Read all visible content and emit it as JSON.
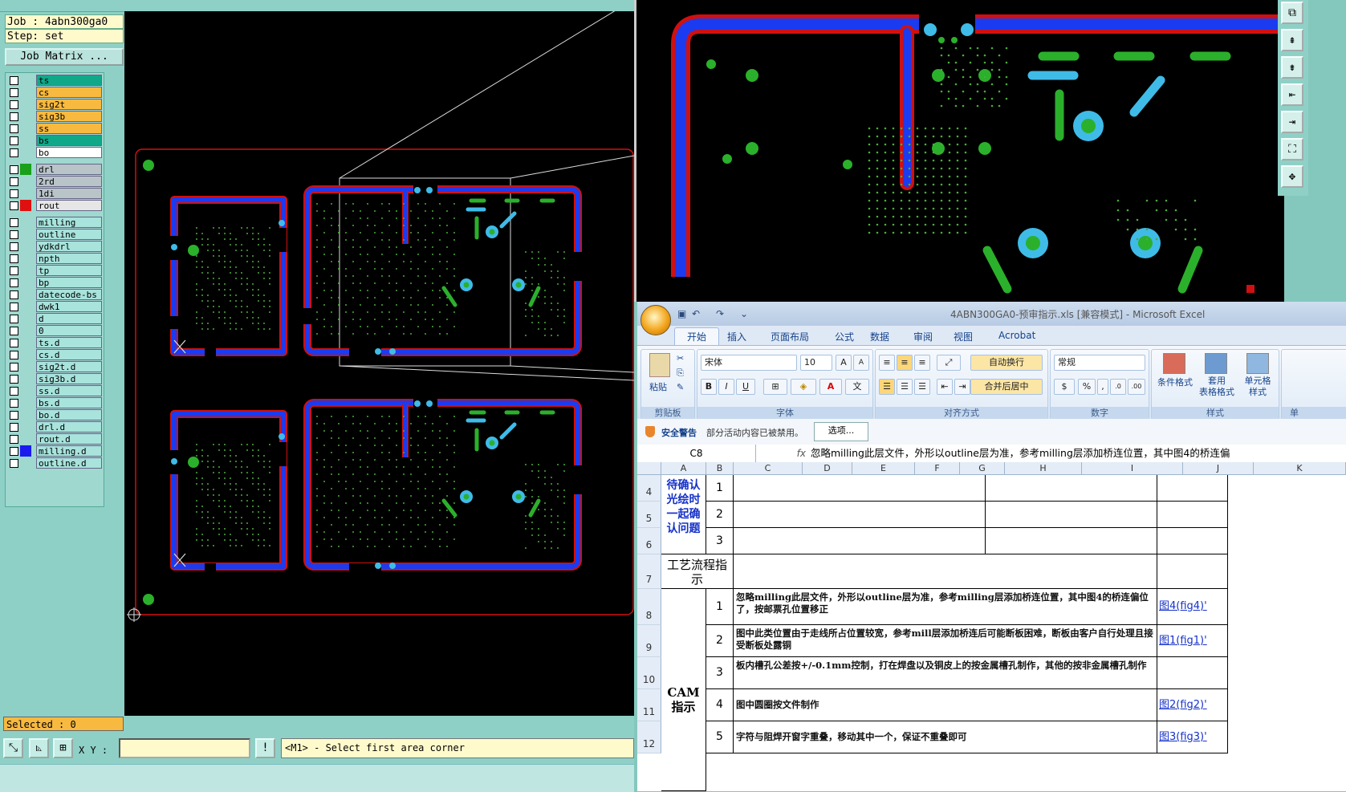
{
  "cam": {
    "job_line": "Job : 4abn300ga0",
    "step_line": "Step: set",
    "job_matrix_label": "Job Matrix ...",
    "layers": [
      {
        "name": "ts",
        "bg": "#11a88a",
        "swatch": ""
      },
      {
        "name": "cs",
        "bg": "#f7b93f",
        "swatch": ""
      },
      {
        "name": "sig2t",
        "bg": "#f7b93f",
        "swatch": ""
      },
      {
        "name": "sig3b",
        "bg": "#f7b93f",
        "swatch": ""
      },
      {
        "name": "ss",
        "bg": "#f7b93f",
        "swatch": ""
      },
      {
        "name": "bs",
        "bg": "#11a88a",
        "swatch": ""
      },
      {
        "name": "bo",
        "bg": "#ffffff",
        "swatch": ""
      },
      {
        "name": "drl",
        "bg": "#b8c4c8",
        "swatch": "#1aa01a"
      },
      {
        "name": "2rd",
        "bg": "#b8c4c8",
        "swatch": ""
      },
      {
        "name": "1di",
        "bg": "#b8c4c8",
        "swatch": ""
      },
      {
        "name": "rout",
        "bg": "#e6e6e6",
        "swatch": "#e01010"
      },
      {
        "name": "milling",
        "bg": "#a8e3dc",
        "swatch": ""
      },
      {
        "name": "outline",
        "bg": "#a8e3dc",
        "swatch": ""
      },
      {
        "name": "ydkdrl",
        "bg": "#a8e3dc",
        "swatch": ""
      },
      {
        "name": "npth",
        "bg": "#a8e3dc",
        "swatch": ""
      },
      {
        "name": "tp",
        "bg": "#a8e3dc",
        "swatch": ""
      },
      {
        "name": "bp",
        "bg": "#a8e3dc",
        "swatch": ""
      },
      {
        "name": "datecode-bs",
        "bg": "#a8e3dc",
        "swatch": ""
      },
      {
        "name": "dwk1",
        "bg": "#a8e3dc",
        "swatch": ""
      },
      {
        "name": "d",
        "bg": "#a8e3dc",
        "swatch": ""
      },
      {
        "name": "0",
        "bg": "#a8e3dc",
        "swatch": ""
      },
      {
        "name": "ts.d",
        "bg": "#a8e3dc",
        "swatch": ""
      },
      {
        "name": "cs.d",
        "bg": "#a8e3dc",
        "swatch": ""
      },
      {
        "name": "sig2t.d",
        "bg": "#a8e3dc",
        "swatch": ""
      },
      {
        "name": "sig3b.d",
        "bg": "#a8e3dc",
        "swatch": ""
      },
      {
        "name": "ss.d",
        "bg": "#a8e3dc",
        "swatch": ""
      },
      {
        "name": "bs.d",
        "bg": "#a8e3dc",
        "swatch": ""
      },
      {
        "name": "bo.d",
        "bg": "#a8e3dc",
        "swatch": ""
      },
      {
        "name": "drl.d",
        "bg": "#a8e3dc",
        "swatch": ""
      },
      {
        "name": "rout.d",
        "bg": "#a8e3dc",
        "swatch": ""
      },
      {
        "name": "milling.d",
        "bg": "#a8e3dc",
        "swatch": "#1b1bf0"
      },
      {
        "name": "outline.d",
        "bg": "#a8e3dc",
        "swatch": ""
      }
    ],
    "selected_label": "Selected : 0",
    "xy_label": "X Y :",
    "warn_glyph": "!",
    "status_message": "<M1> - Select first area corner"
  },
  "excel": {
    "title": "4ABN300GA0-预审指示.xls  [兼容模式] - Microsoft Excel",
    "tabs": [
      "开始",
      "插入",
      "页面布局",
      "公式",
      "数据",
      "审阅",
      "视图",
      "Acrobat"
    ],
    "groups": {
      "clipboard": "剪贴板",
      "font": "字体",
      "align": "对齐方式",
      "number": "数字",
      "styles": "样式",
      "cells": "单"
    },
    "paste_label": "粘贴",
    "font_name": "宋体",
    "font_size": "10",
    "wrap_label": "自动换行",
    "merge_label": "合并后居中",
    "number_format": "常规",
    "cond_format_label": "条件格式",
    "table_format_label": "套用\n表格格式",
    "cell_style_label": "单元格\n样式",
    "security_title": "安全警告",
    "security_msg": "部分活动内容已被禁用。",
    "security_btn": "选项...",
    "name_box": "C8",
    "fx": "fx",
    "formula": "忽略milling此层文件，外形以outline层为准，参考milling层添加桥连位置，其中图4的桥连偏",
    "columns": [
      "A",
      "B",
      "C",
      "D",
      "E",
      "F",
      "G",
      "H",
      "I",
      "J",
      "K"
    ],
    "rows": [
      "4",
      "5",
      "6",
      "7",
      "8",
      "9",
      "10",
      "11",
      "12"
    ],
    "confirm_label": "待确认光绘时一起确认问题",
    "process_label": "工艺流程指示",
    "cam_label": "CAM\n指示",
    "confirm_nums": [
      "1",
      "2",
      "3"
    ],
    "cam_items": [
      {
        "n": "1",
        "text": "忽略milling此层文件，外形以outline层为准，参考milling层添加桥连位置，其中图4的桥连偏位了，按邮票孔位置移正",
        "link": "图4(fig4)'"
      },
      {
        "n": "2",
        "text": "图中此类位置由于走线所占位置较宽，参考mill层添加桥连后可能断板困难，断板由客户自行处理且接受断板处露铜",
        "link": "图1(fig1)'"
      },
      {
        "n": "3",
        "text": "板内槽孔公差按+/-0.1mm控制，打在焊盘以及铜皮上的按金属槽孔制作，其他的按非金属槽孔制作",
        "link": ""
      },
      {
        "n": "4",
        "text": "图中圆圈按文件制作",
        "link": "图2(fig2)'"
      },
      {
        "n": "5",
        "text": "字符与阻焊开窗字重叠，移动其中一个，保证不重叠即可",
        "link": "图3(fig3)'"
      }
    ]
  }
}
